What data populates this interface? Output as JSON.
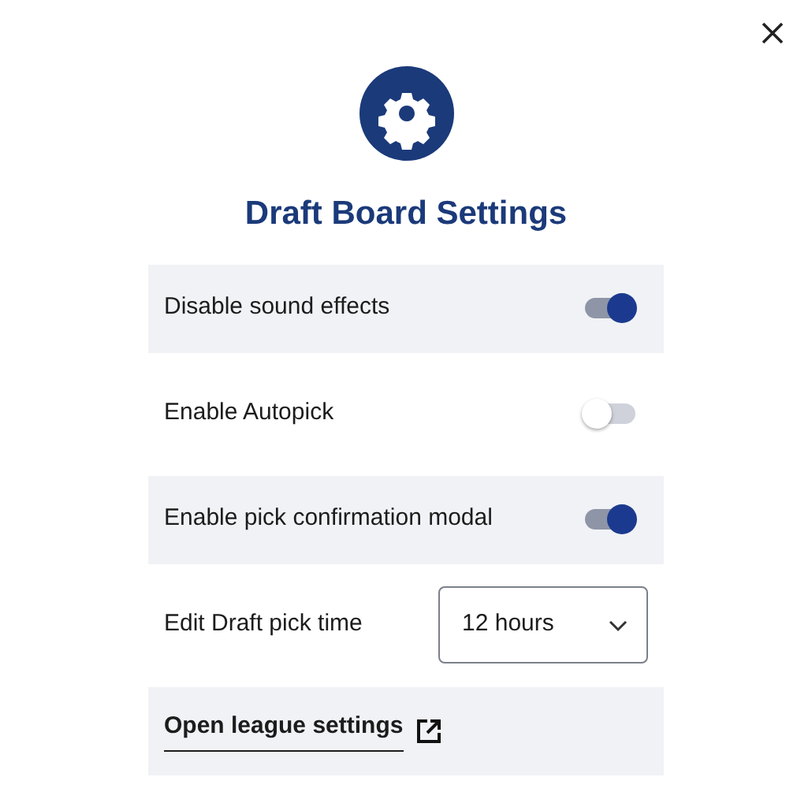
{
  "dialog": {
    "title": "Draft Board Settings"
  },
  "settings": [
    {
      "kind": "toggle",
      "label": "Disable sound effects",
      "on": true
    },
    {
      "kind": "toggle",
      "label": "Enable Autopick",
      "on": false
    },
    {
      "kind": "toggle",
      "label": "Enable pick confirmation modal",
      "on": true
    },
    {
      "kind": "select",
      "label": "Edit Draft pick time",
      "value": "12 hours"
    },
    {
      "kind": "link",
      "label": "Open league settings"
    }
  ]
}
